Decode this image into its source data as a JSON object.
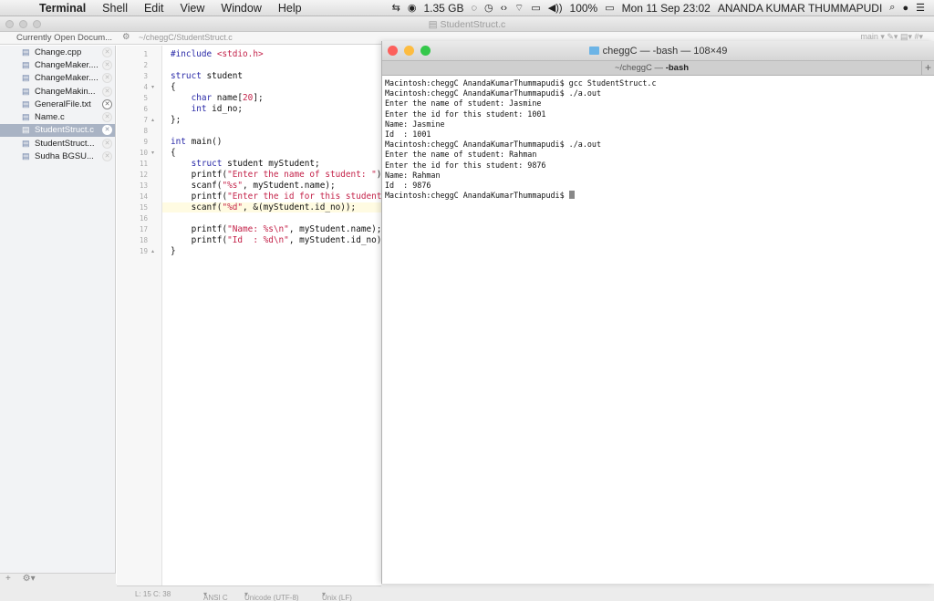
{
  "menubar": {
    "apple": "",
    "app": "Terminal",
    "items": [
      "Shell",
      "Edit",
      "View",
      "Window",
      "Help"
    ],
    "memory": "1.35 GB",
    "battery": "100%",
    "datetime": "Mon 11 Sep  23:02",
    "user": "ANANDA KUMAR THUMMAPUDI"
  },
  "editor": {
    "window_title": "StudentStruct.c",
    "docs_label": "Currently Open Docum...",
    "path": "~/cheggC/StudentStruct.c",
    "toolbar_right": "main ▾   ✎▾   ▤▾   #▾",
    "files": [
      {
        "name": "Change.cpp",
        "selected": false,
        "dirty": false
      },
      {
        "name": "ChangeMaker....",
        "selected": false,
        "dirty": false
      },
      {
        "name": "ChangeMaker....",
        "selected": false,
        "dirty": false
      },
      {
        "name": "ChangeMakin...",
        "selected": false,
        "dirty": false
      },
      {
        "name": "GeneralFile.txt",
        "selected": false,
        "dirty": true
      },
      {
        "name": "Name.c",
        "selected": false,
        "dirty": false
      },
      {
        "name": "StudentStruct.c",
        "selected": true,
        "dirty": false
      },
      {
        "name": "StudentStruct...",
        "selected": false,
        "dirty": false
      },
      {
        "name": "Sudha BGSU...",
        "selected": false,
        "dirty": false
      }
    ],
    "line_numbers": [
      "1",
      "2",
      "3",
      "4",
      "5",
      "6",
      "7",
      "8",
      "9",
      "10",
      "11",
      "12",
      "13",
      "14",
      "15",
      "16",
      "17",
      "18",
      "19"
    ],
    "code_lines": [
      [
        {
          "t": "#include ",
          "c": "kw"
        },
        {
          "t": "<stdio.h>",
          "c": "str"
        }
      ],
      [],
      [
        {
          "t": "struct",
          "c": "kw"
        },
        {
          "t": " student",
          "c": ""
        }
      ],
      [
        {
          "t": "{",
          "c": ""
        }
      ],
      [
        {
          "t": "    ",
          "c": ""
        },
        {
          "t": "char",
          "c": "kw"
        },
        {
          "t": " name[",
          "c": ""
        },
        {
          "t": "20",
          "c": "num"
        },
        {
          "t": "];",
          "c": ""
        }
      ],
      [
        {
          "t": "    ",
          "c": ""
        },
        {
          "t": "int",
          "c": "kw"
        },
        {
          "t": " id_no;",
          "c": ""
        }
      ],
      [
        {
          "t": "};",
          "c": ""
        }
      ],
      [],
      [
        {
          "t": "int",
          "c": "kw"
        },
        {
          "t": " main()",
          "c": ""
        }
      ],
      [
        {
          "t": "{",
          "c": ""
        }
      ],
      [
        {
          "t": "    ",
          "c": ""
        },
        {
          "t": "struct",
          "c": "kw"
        },
        {
          "t": " student myStudent;",
          "c": ""
        }
      ],
      [
        {
          "t": "    printf(",
          "c": ""
        },
        {
          "t": "\"Enter the name of student: \"",
          "c": "str"
        },
        {
          "t": ");",
          "c": ""
        }
      ],
      [
        {
          "t": "    scanf(",
          "c": ""
        },
        {
          "t": "\"%s\"",
          "c": "str"
        },
        {
          "t": ", myStudent.name);",
          "c": ""
        }
      ],
      [
        {
          "t": "    printf(",
          "c": ""
        },
        {
          "t": "\"Enter the id for this student: \"",
          "c": "str"
        },
        {
          "t": ");",
          "c": ""
        }
      ],
      [
        {
          "t": "    scanf(",
          "c": ""
        },
        {
          "t": "\"%d\"",
          "c": "str"
        },
        {
          "t": ", &(myStudent.id_no));",
          "c": ""
        }
      ],
      [],
      [
        {
          "t": "    printf(",
          "c": ""
        },
        {
          "t": "\"Name: %s\\n\"",
          "c": "str"
        },
        {
          "t": ", myStudent.name);",
          "c": ""
        }
      ],
      [
        {
          "t": "    printf(",
          "c": ""
        },
        {
          "t": "\"Id  : %d\\n\"",
          "c": "str"
        },
        {
          "t": ", myStudent.id_no);",
          "c": ""
        }
      ],
      [
        {
          "t": "}",
          "c": ""
        }
      ]
    ],
    "status": {
      "position": "L: 15 C: 38",
      "encoding_type": "ANSI C",
      "charset": "Unicode (UTF-8)",
      "line_endings": "Unix (LF)"
    }
  },
  "terminal": {
    "title": "cheggC — -bash — 108×49",
    "tab_prefix": "~/cheggC — ",
    "tab_bold": "-bash",
    "lines": [
      "Macintosh:cheggC AnandaKumarThummapudi$ gcc StudentStruct.c",
      "Macintosh:cheggC AnandaKumarThummapudi$ ./a.out",
      "Enter the name of student: Jasmine",
      "Enter the id for this student: 1001",
      "Name: Jasmine",
      "Id  : 1001",
      "Macintosh:cheggC AnandaKumarThummapudi$ ./a.out",
      "Enter the name of student: Rahman",
      "Enter the id for this student: 9876",
      "Name: Rahman",
      "Id  : 9876",
      "Macintosh:cheggC AnandaKumarThummapudi$ "
    ],
    "colors": {
      "close": "#fc605c",
      "minimize": "#fdbc40",
      "zoom": "#34c84a"
    }
  }
}
